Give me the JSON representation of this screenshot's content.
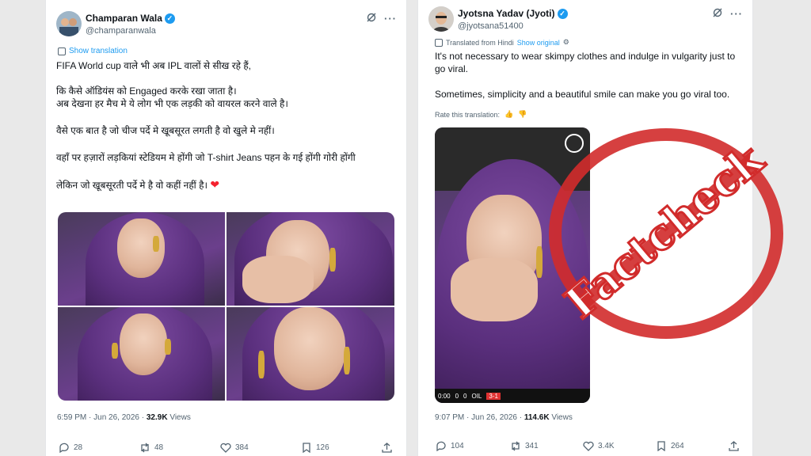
{
  "left_tweet": {
    "author": "Champaran Wala",
    "handle": "@champaranwala",
    "show_translation": "Show translation",
    "lines": [
      "FIFA World cup वाले भी अब IPL वालों से सीख रहे हैं,",
      "कि कैसे ऑडियंस को Engaged करके रखा जाता है।",
      "अब देखना हर मैच मे ये लोग भी एक लड़की को वायरल करने वाले है।",
      "वैसे एक बात है जो चीज पर्दे मे खूबसूरत लगती है वो खुले मे नहीं।",
      "वहाँ पर हज़ारों लड़कियां स्टेडियम मे होंगी जो T-shirt Jeans पहन के गई होंगी गोरी होंगी",
      "लेकिन जो खूबसूरती पर्दे मे है वो कहीं नहीं है।"
    ],
    "heart": "❤",
    "time": "6:59 PM · Jun 26, 2026 ·",
    "views_count": "32.9K",
    "views_label": "Views",
    "replies": "28",
    "reposts": "48",
    "likes": "384",
    "bookmarks": "126"
  },
  "right_tweet": {
    "author": "Jyotsna Yadav (Jyoti)",
    "handle": "@jyotsana51400",
    "translated_from": "Translated from Hindi",
    "show_original": "Show original",
    "text1": "It's not necessary to wear skimpy clothes and indulge in vulgarity just to go viral.",
    "text2": "Sometimes, simplicity and a beautiful smile can make you go viral too.",
    "rate": "Rate this translation:",
    "time": "9:07 PM · Jun 26, 2026 ·",
    "views_count": "114.6K",
    "views_label": "Views",
    "replies": "104",
    "reposts": "341",
    "likes": "3.4K",
    "bookmarks": "264",
    "score_time": "0:00",
    "score_left": "0",
    "score_right": "0",
    "score_team": "OIL",
    "score_result": "3-1"
  },
  "stamp_text": "Factcheck",
  "colors": {
    "accent": "#1d9bf0",
    "stamp": "#d12b2b",
    "scarf": "#5a2f7d"
  }
}
